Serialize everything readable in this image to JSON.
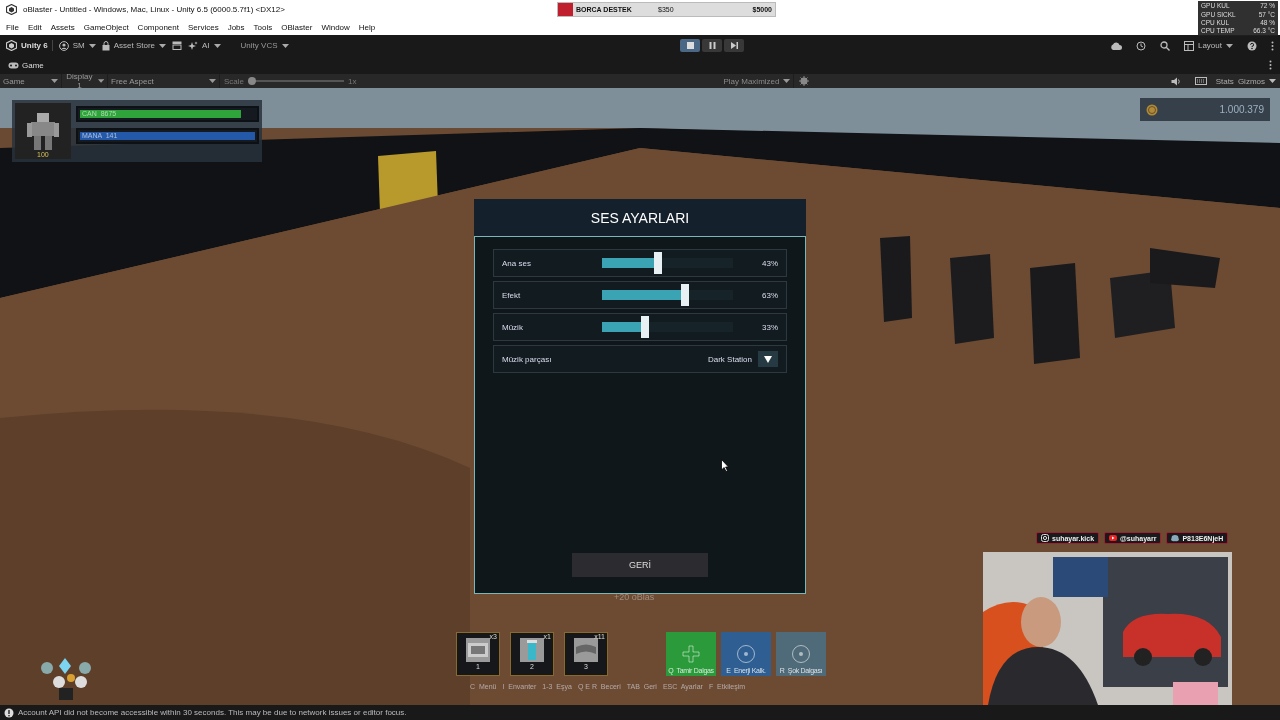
{
  "window": {
    "title": "oBlaster - Untitled - Windows, Mac, Linux - Unity 6.5 (6000.5.7f1) <DX12>"
  },
  "donation_bar": {
    "label": "BORCA DESTEK",
    "amount": "$350",
    "goal": "$5000",
    "level": 0.07
  },
  "perf_overlay": [
    {
      "label": "GPU KUL",
      "value": "72 %"
    },
    {
      "label": "GPU SICKL",
      "value": "57 °C"
    },
    {
      "label": "CPU KUL",
      "value": "48 %"
    },
    {
      "label": "CPU TEMP",
      "value": "66.3 °C"
    }
  ],
  "menu": [
    "File",
    "Edit",
    "Assets",
    "GameObject",
    "Component",
    "Services",
    "Jobs",
    "Tools",
    "OBlaster",
    "Window",
    "Help"
  ],
  "toolbar": {
    "account": "Unity 6",
    "user": "SM",
    "asset_store": "Asset Store",
    "ai": "AI",
    "vcs": "Unity VCS",
    "layout": "Layout",
    "play_controls": [
      {
        "kind": "stop",
        "selected": true
      },
      {
        "kind": "pause",
        "selected": false
      },
      {
        "kind": "step",
        "selected": false
      }
    ]
  },
  "tabs": [
    {
      "label": "Game",
      "selected": true
    }
  ],
  "game_toolbar": {
    "view": "Game",
    "display": "Display 1",
    "aspect": "Free Aspect",
    "scale_label": "Scale",
    "scale": "1x",
    "scale_slider": {
      "level": 0
    },
    "play_mode": "Play Maximized",
    "stats": "Stats",
    "gizmos": "Gizmos"
  },
  "hud": {
    "portrait_level": "100",
    "bars": [
      {
        "label": "CAN  8675",
        "level": 0.9,
        "color": "#2ea43a"
      },
      {
        "label": "MANA  141",
        "level": 1,
        "color": "#2458a8"
      }
    ],
    "coins": "1.000.379"
  },
  "settings": {
    "title": "SES AYARLARI",
    "back": "GERİ",
    "rows": [
      {
        "kind": "slider",
        "label": "Ana ses",
        "level": 0.43,
        "reading": "43%"
      },
      {
        "kind": "slider",
        "label": "Efekt",
        "level": 0.63,
        "reading": "63%"
      },
      {
        "kind": "slider",
        "label": "Müzik",
        "level": 0.33,
        "reading": "33%"
      },
      {
        "kind": "dropdown",
        "label": "Müzik parçası",
        "value": "Dark Station"
      }
    ]
  },
  "floating_text": "+20 oBlas",
  "hotbar": {
    "items": [
      {
        "count": "x3",
        "key": "1"
      },
      {
        "count": "x1",
        "key": "2"
      },
      {
        "count": "x11",
        "key": "3"
      }
    ],
    "skills": [
      {
        "label": "Q  Tamir Dalgas",
        "color": "#2a9a3a"
      },
      {
        "label": "E  Enerji Kalk.",
        "color": "#2f5f92"
      },
      {
        "label": "R  Şok Dalgası",
        "color": "#4f6a78"
      }
    ],
    "hints": [
      {
        "key": "C",
        "action": "Menü"
      },
      {
        "key": "I",
        "action": "Envanter"
      },
      {
        "key": "1-3",
        "action": "Eşya"
      },
      {
        "key": "Q E R",
        "action": "Beceri"
      },
      {
        "key": "TAB",
        "action": "Geri"
      },
      {
        "key": "ESC",
        "action": "Ayarlar"
      },
      {
        "key": "F",
        "action": "Etkileşim"
      }
    ]
  },
  "socials": [
    {
      "kind": "instagram",
      "handle": "suhayar.kick"
    },
    {
      "kind": "youtube",
      "handle": "@suhayarr"
    },
    {
      "kind": "discord",
      "handle": "P813E6NjeH"
    }
  ],
  "status_bar": {
    "message": "Account API did not become accessible within 30 seconds. This may be due to network issues or editor focus."
  }
}
